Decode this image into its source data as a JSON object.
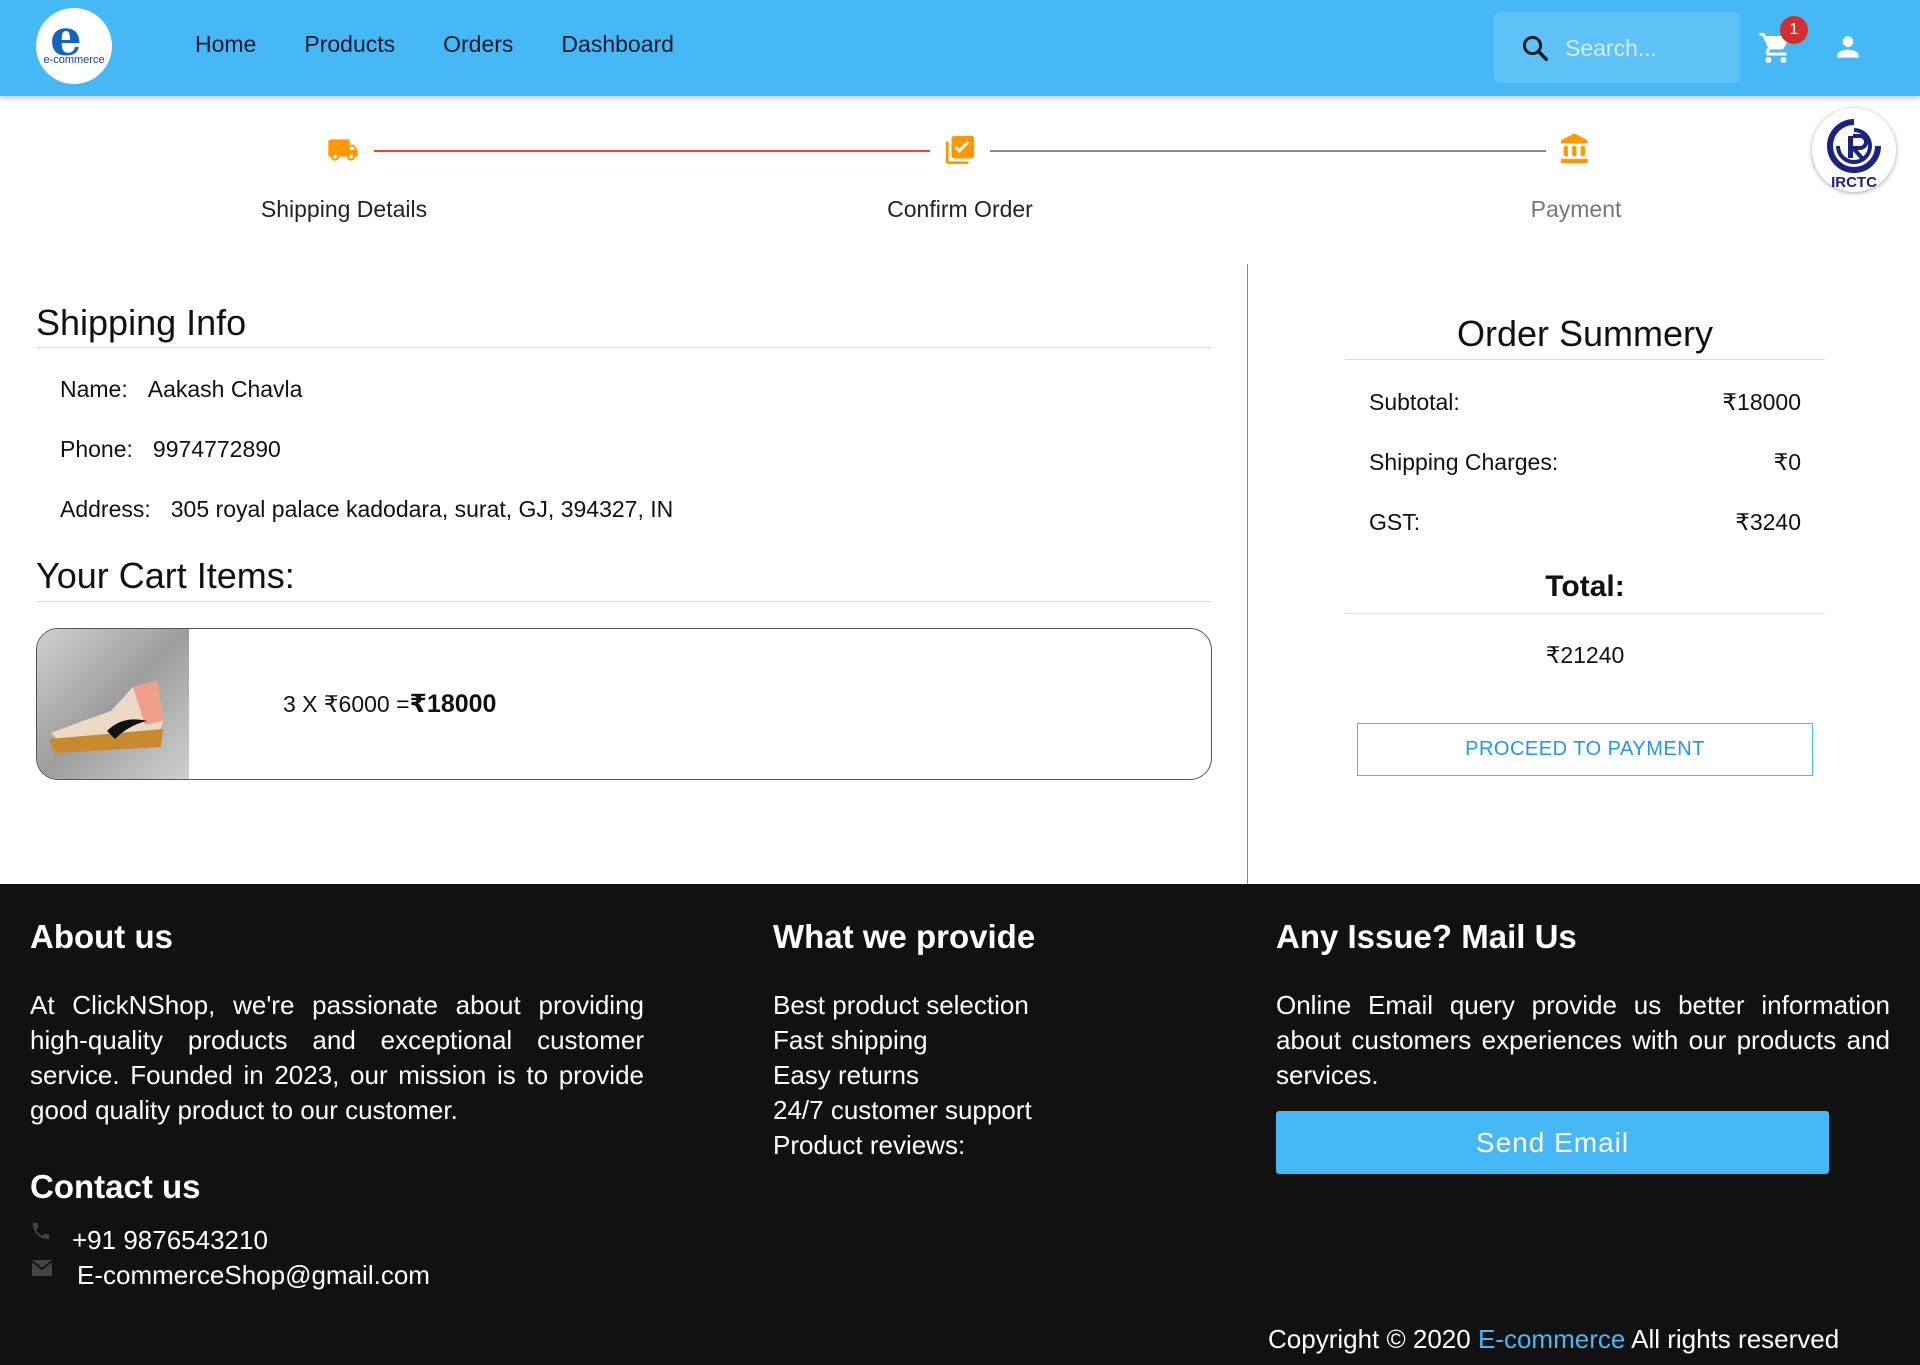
{
  "header": {
    "logo_letter": "e",
    "logo_text": "e-commerce",
    "nav": [
      "Home",
      "Products",
      "Orders",
      "Dashboard"
    ],
    "search_placeholder": "Search...",
    "cart_count": "1"
  },
  "stepper": {
    "steps": [
      "Shipping Details",
      "Confirm Order",
      "Payment"
    ],
    "active_color": "#ff9800",
    "line_done_color": "#f44336",
    "line_pending_color": "#888888"
  },
  "irctc": {
    "label": "IRCTC"
  },
  "shipping": {
    "title": "Shipping Info",
    "name_label": "Name:",
    "name": "Aakash Chavla",
    "phone_label": "Phone:",
    "phone": "9974772890",
    "address_label": "Address:",
    "address": "305 royal palace kadodara, surat, GJ, 394327, IN"
  },
  "cart": {
    "title": "Your Cart Items:",
    "item_qty_text": "3 X ₹6000 =",
    "item_total": "₹18000"
  },
  "summary": {
    "title": "Order Summery",
    "subtotal_label": "Subtotal:",
    "subtotal": "₹18000",
    "shipping_label": "Shipping Charges:",
    "shipping": "₹0",
    "gst_label": "GST:",
    "gst": "₹3240",
    "total_label": "Total:",
    "total": "₹21240",
    "button": "PROCEED TO PAYMENT"
  },
  "footer": {
    "about_title": "About us",
    "about_text": "At ClickNShop, we're passionate about providing high-quality products and exceptional customer service. Founded in 2023, our mission is to provide good quality product to our customer.",
    "provide_title": "What we provide",
    "provide_items": [
      "Best product selection",
      "Fast shipping",
      "Easy returns",
      "24/7 customer support",
      "Product reviews:"
    ],
    "issue_title": "Any Issue? Mail Us",
    "issue_text": "Online Email query provide us better information about customers experiences with our products and services.",
    "send_button": "Send Email",
    "contact_title": "Contact us",
    "phone": "+91 9876543210",
    "email": "E-commerceShop@gmail.com",
    "copyright_prefix": "Copyright © 2020",
    "copyright_brand": "E-commerce",
    "copyright_suffix": "All rights reserved"
  },
  "colors": {
    "primary": "#45b8f5",
    "badge": "#d32f2f",
    "footer_bg": "#111111",
    "step_icon": "#ff9800"
  }
}
